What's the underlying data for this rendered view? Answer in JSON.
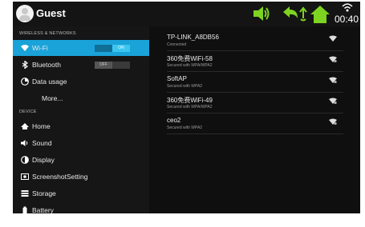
{
  "statusbar": {
    "user": "Guest",
    "time": "00:40"
  },
  "sidebar": {
    "section_wireless": "WIRELESS & NETWORKS",
    "section_device": "DEVICE",
    "items": [
      {
        "label": "Wi-Fi",
        "toggle": "ON"
      },
      {
        "label": "Bluetooth",
        "toggle": "OFF"
      },
      {
        "label": "Data usage"
      },
      {
        "label": "More..."
      },
      {
        "label": "Home"
      },
      {
        "label": "Sound"
      },
      {
        "label": "Display"
      },
      {
        "label": "ScreenshotSetting"
      },
      {
        "label": "Storage"
      },
      {
        "label": "Battery"
      }
    ]
  },
  "networks": [
    {
      "ssid": "TP-LINK_A8DB56",
      "status": "Connected"
    },
    {
      "ssid": "360免费WiFi-58",
      "status": "Secured with WPA/WPA2"
    },
    {
      "ssid": "SoftAP",
      "status": "Secured with WPA2"
    },
    {
      "ssid": "360免费WiFi-49",
      "status": "Secured with WPA/WPA2"
    },
    {
      "ssid": "ceo2",
      "status": "Secured with WPA2"
    }
  ],
  "colors": {
    "accent": "#1aa3d9",
    "nav_green": "#7ed321"
  }
}
